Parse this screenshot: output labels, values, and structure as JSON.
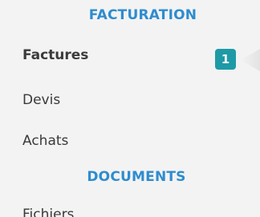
{
  "theme": {
    "section_color": "#2e8ccf",
    "badge_color": "#1e9aa7"
  },
  "sidebar": {
    "sections": [
      {
        "title": "FACTURATION",
        "items": [
          {
            "label": "Factures",
            "active": true,
            "badge": "1"
          },
          {
            "label": "Devis"
          },
          {
            "label": "Achats"
          }
        ]
      },
      {
        "title": "DOCUMENTS",
        "items": [
          {
            "label": "Fichiers",
            "partially_visible": true
          }
        ]
      }
    ]
  }
}
